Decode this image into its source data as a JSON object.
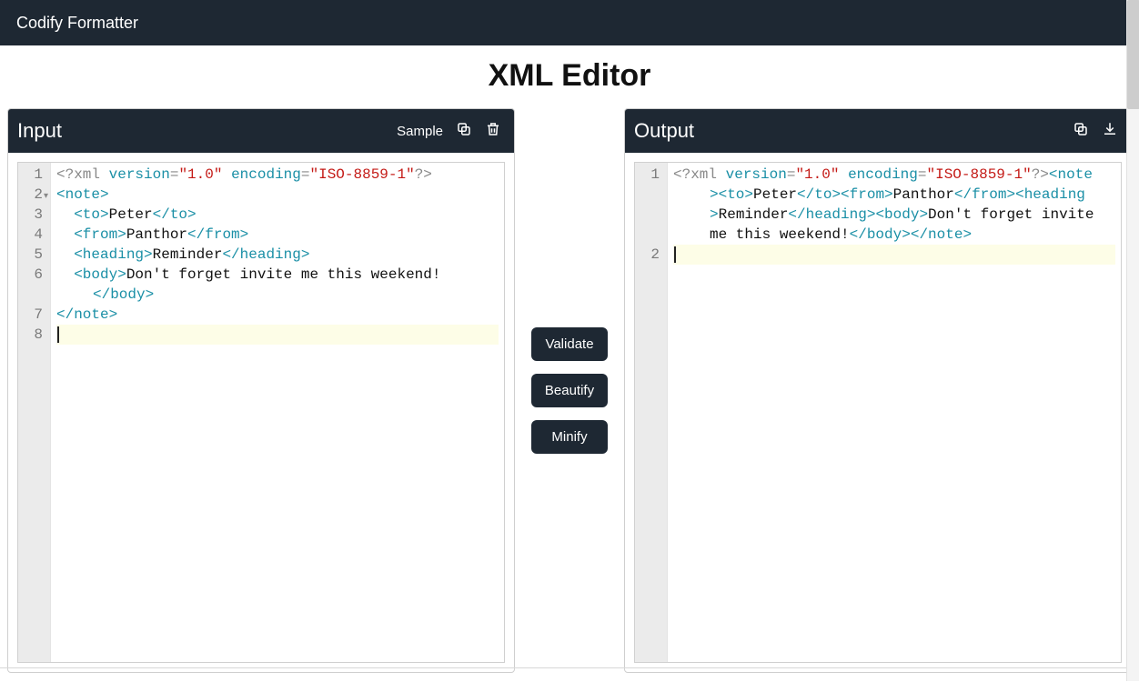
{
  "app": {
    "name": "Codify Formatter"
  },
  "page": {
    "title": "XML Editor"
  },
  "panels": {
    "input": {
      "title": "Input",
      "sample_label": "Sample",
      "lines": [
        {
          "n": "1",
          "fold": false,
          "hl": false,
          "tokens": [
            {
              "cls": "t-pi",
              "t": "<?xml "
            },
            {
              "cls": "t-tag",
              "t": "version"
            },
            {
              "cls": "t-pi",
              "t": "="
            },
            {
              "cls": "t-str",
              "t": "\"1.0\""
            },
            {
              "cls": "t-pi",
              "t": " "
            },
            {
              "cls": "t-tag",
              "t": "encoding"
            },
            {
              "cls": "t-pi",
              "t": "="
            },
            {
              "cls": "t-str",
              "t": "\"ISO-8859-1\""
            },
            {
              "cls": "t-pi",
              "t": "?>"
            }
          ]
        },
        {
          "n": "2",
          "fold": true,
          "hl": false,
          "tokens": [
            {
              "cls": "t-tag",
              "t": "<note>"
            }
          ]
        },
        {
          "n": "3",
          "fold": false,
          "hl": false,
          "tokens": [
            {
              "cls": "t-text",
              "t": "  "
            },
            {
              "cls": "t-tag",
              "t": "<to>"
            },
            {
              "cls": "t-text",
              "t": "Peter"
            },
            {
              "cls": "t-tag",
              "t": "</to>"
            }
          ]
        },
        {
          "n": "4",
          "fold": false,
          "hl": false,
          "tokens": [
            {
              "cls": "t-text",
              "t": "  "
            },
            {
              "cls": "t-tag",
              "t": "<from>"
            },
            {
              "cls": "t-text",
              "t": "Panthor"
            },
            {
              "cls": "t-tag",
              "t": "</from>"
            }
          ]
        },
        {
          "n": "5",
          "fold": false,
          "hl": false,
          "tokens": [
            {
              "cls": "t-text",
              "t": "  "
            },
            {
              "cls": "t-tag",
              "t": "<heading>"
            },
            {
              "cls": "t-text",
              "t": "Reminder"
            },
            {
              "cls": "t-tag",
              "t": "</heading>"
            }
          ]
        },
        {
          "n": "6",
          "fold": false,
          "hl": false,
          "tokens": [
            {
              "cls": "t-text",
              "t": "  "
            },
            {
              "cls": "t-tag",
              "t": "<body>"
            },
            {
              "cls": "t-text",
              "t": "Don't forget invite me this weekend!"
            }
          ]
        },
        {
          "n": "",
          "fold": false,
          "hl": false,
          "wrap": true,
          "tokens": [
            {
              "cls": "t-tag",
              "t": "</body>"
            }
          ]
        },
        {
          "n": "7",
          "fold": false,
          "hl": false,
          "tokens": [
            {
              "cls": "t-tag",
              "t": "</note>"
            }
          ]
        },
        {
          "n": "8",
          "fold": false,
          "hl": true,
          "cursor": true,
          "tokens": []
        }
      ]
    },
    "output": {
      "title": "Output",
      "lines": [
        {
          "n": "1",
          "hl": false,
          "tokens": [
            {
              "cls": "t-pi",
              "t": "<?xml "
            },
            {
              "cls": "t-tag",
              "t": "version"
            },
            {
              "cls": "t-pi",
              "t": "="
            },
            {
              "cls": "t-str",
              "t": "\"1.0\""
            },
            {
              "cls": "t-pi",
              "t": " "
            },
            {
              "cls": "t-tag",
              "t": "encoding"
            },
            {
              "cls": "t-pi",
              "t": "="
            },
            {
              "cls": "t-str",
              "t": "\"ISO-8859-1\""
            },
            {
              "cls": "t-pi",
              "t": "?>"
            },
            {
              "cls": "t-tag",
              "t": "<note"
            }
          ]
        },
        {
          "n": "",
          "wrap": true,
          "hl": false,
          "tokens": [
            {
              "cls": "t-tag",
              "t": "><to>"
            },
            {
              "cls": "t-text",
              "t": "Peter"
            },
            {
              "cls": "t-tag",
              "t": "</to><from>"
            },
            {
              "cls": "t-text",
              "t": "Panthor"
            },
            {
              "cls": "t-tag",
              "t": "</from><heading"
            }
          ]
        },
        {
          "n": "",
          "wrap": true,
          "hl": false,
          "tokens": [
            {
              "cls": "t-tag",
              "t": ">"
            },
            {
              "cls": "t-text",
              "t": "Reminder"
            },
            {
              "cls": "t-tag",
              "t": "</heading><body>"
            },
            {
              "cls": "t-text",
              "t": "Don't forget invite"
            }
          ]
        },
        {
          "n": "",
          "wrap": true,
          "hl": false,
          "tokens": [
            {
              "cls": "t-text",
              "t": "me this weekend!"
            },
            {
              "cls": "t-tag",
              "t": "</body></note>"
            }
          ]
        },
        {
          "n": "2",
          "hl": true,
          "cursor": true,
          "tokens": []
        }
      ]
    }
  },
  "actions": {
    "validate": "Validate",
    "beautify": "Beautify",
    "minify": "Minify"
  }
}
